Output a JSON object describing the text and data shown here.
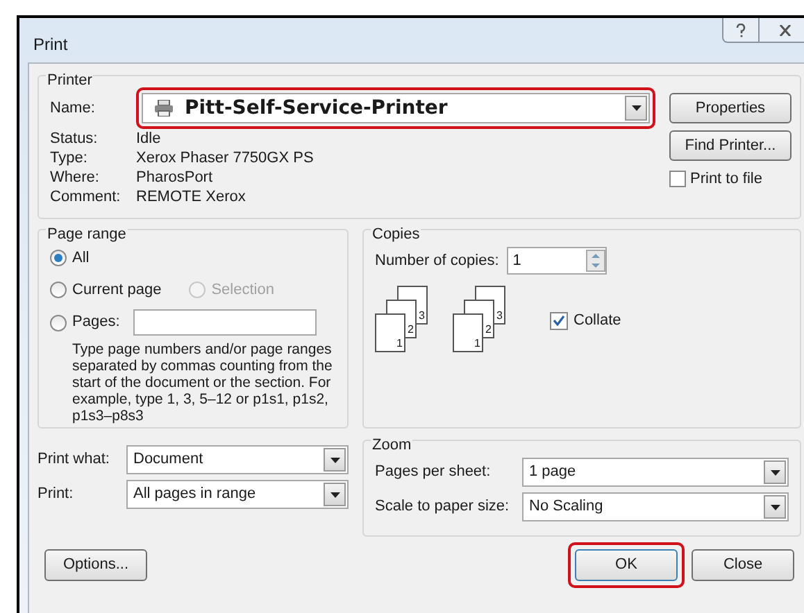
{
  "window": {
    "title": "Print"
  },
  "printer": {
    "label": "Printer",
    "name_label": "Name:",
    "name_value": "Pitt-Self-Service-Printer",
    "name_highlighted": true,
    "details": [
      {
        "label": "Status:",
        "value": "Idle"
      },
      {
        "label": "Type:",
        "value": "Xerox Phaser 7750GX PS"
      },
      {
        "label": "Where:",
        "value": "PharosPort"
      },
      {
        "label": "Comment:",
        "value": "REMOTE Xerox"
      }
    ],
    "buttons": [
      "Properties",
      "Find Printer..."
    ],
    "print_to_file": {
      "label": "Print to file",
      "checked": false
    }
  },
  "page_range": {
    "label": "Page range",
    "rows": [
      [
        {
          "label": "All",
          "selected": true,
          "disabled": false,
          "kind": "radio"
        }
      ],
      [
        {
          "label": "Current page",
          "selected": false,
          "disabled": false,
          "kind": "radio"
        },
        {
          "label": "Selection",
          "selected": false,
          "disabled": true,
          "kind": "radio"
        }
      ],
      [
        {
          "label": "Pages:",
          "selected": false,
          "disabled": false,
          "kind": "radio_field"
        }
      ]
    ],
    "hint": "Type page numbers and/or page ranges separated by commas counting from the start of the document or the section. For example, type 1, 3, 5–12 or p1s1, p1s2, p1s3–p8s3"
  },
  "copies": {
    "label": "Copies",
    "number_label": "Number of copies:",
    "number_value": "1",
    "illustrations": [
      [
        "1",
        "2",
        "3"
      ],
      [
        "1",
        "2",
        "3"
      ]
    ],
    "collate": {
      "label": "Collate",
      "checked": true
    }
  },
  "print_options": [
    {
      "label": "Print what:",
      "value": "Document"
    },
    {
      "label": "Print:",
      "value": "All pages in range"
    }
  ],
  "zoom": {
    "label": "Zoom",
    "rows": [
      {
        "label": "Pages per sheet:",
        "value": "1 page"
      },
      {
        "label": "Scale to paper size:",
        "value": "No Scaling"
      }
    ]
  },
  "buttons": [
    {
      "label": "Options...",
      "kind": "left",
      "highlighted": false
    },
    {
      "label": "OK",
      "kind": "right",
      "highlighted": true
    },
    {
      "label": "Close",
      "kind": "right",
      "highlighted": false
    }
  ]
}
